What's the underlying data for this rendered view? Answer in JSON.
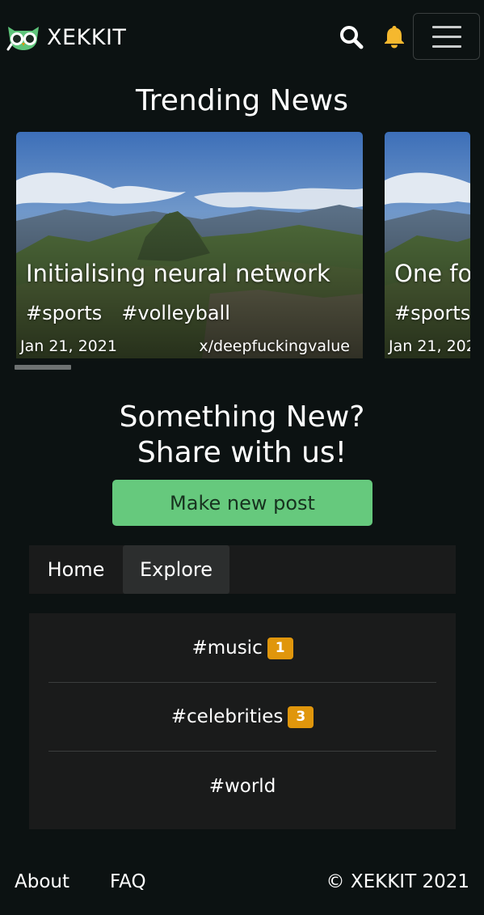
{
  "navbar": {
    "brand": "XEKKIT",
    "logo_icon": "owl-logo-icon",
    "search_icon": "search-icon",
    "bell_icon": "bell-icon",
    "menu_icon": "hamburger-menu-icon",
    "bell_color": "#f5b82e"
  },
  "trending": {
    "title": "Trending News",
    "cards": [
      {
        "title": "Initialising neural network",
        "tags": [
          "#sports",
          "#volleyball"
        ],
        "date": "Jan 21, 2021",
        "author": "x/deepfuckingvalue"
      },
      {
        "title": "One fo",
        "tags": [
          "#sports"
        ],
        "date": "Jan 21, 202",
        "author": ""
      }
    ]
  },
  "share": {
    "line1": "Something New?",
    "line2": "Share with us!",
    "button": "Make new post",
    "button_color": "#66c97d"
  },
  "tabs": [
    {
      "label": "Home",
      "active": false
    },
    {
      "label": "Explore",
      "active": true
    }
  ],
  "tag_list": [
    {
      "label": "#music",
      "count": "1"
    },
    {
      "label": "#celebrities",
      "count": "3"
    },
    {
      "label": "#world",
      "count": ""
    }
  ],
  "badge_color": "#e0960c",
  "footer": {
    "about": "About",
    "faq": "FAQ",
    "copyright": "© XEKKIT 2021"
  }
}
